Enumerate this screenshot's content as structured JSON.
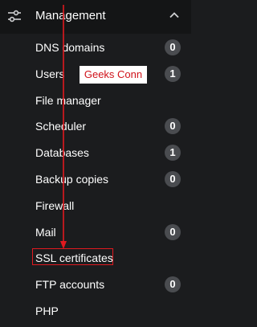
{
  "header": {
    "title": "Management",
    "icon": "sliders-icon",
    "toggle_icon": "chevron-up-icon"
  },
  "menu": {
    "items": [
      {
        "label": "DNS domains",
        "badge": "0"
      },
      {
        "label": "Users",
        "badge": "1"
      },
      {
        "label": "File manager",
        "badge": null
      },
      {
        "label": "Scheduler",
        "badge": "0"
      },
      {
        "label": "Databases",
        "badge": "1"
      },
      {
        "label": "Backup copies",
        "badge": "0"
      },
      {
        "label": "Firewall",
        "badge": null
      },
      {
        "label": "Mail",
        "badge": "0"
      },
      {
        "label": "SSL certificates",
        "badge": null
      },
      {
        "label": "FTP accounts",
        "badge": "0"
      },
      {
        "label": "PHP",
        "badge": null
      }
    ]
  },
  "annotation": {
    "watermark": "Geeks Conn",
    "highlight_color": "#e0191f"
  },
  "colors": {
    "background": "#1b1c1e",
    "header_background": "#141516",
    "badge_background": "#4a4c50"
  }
}
